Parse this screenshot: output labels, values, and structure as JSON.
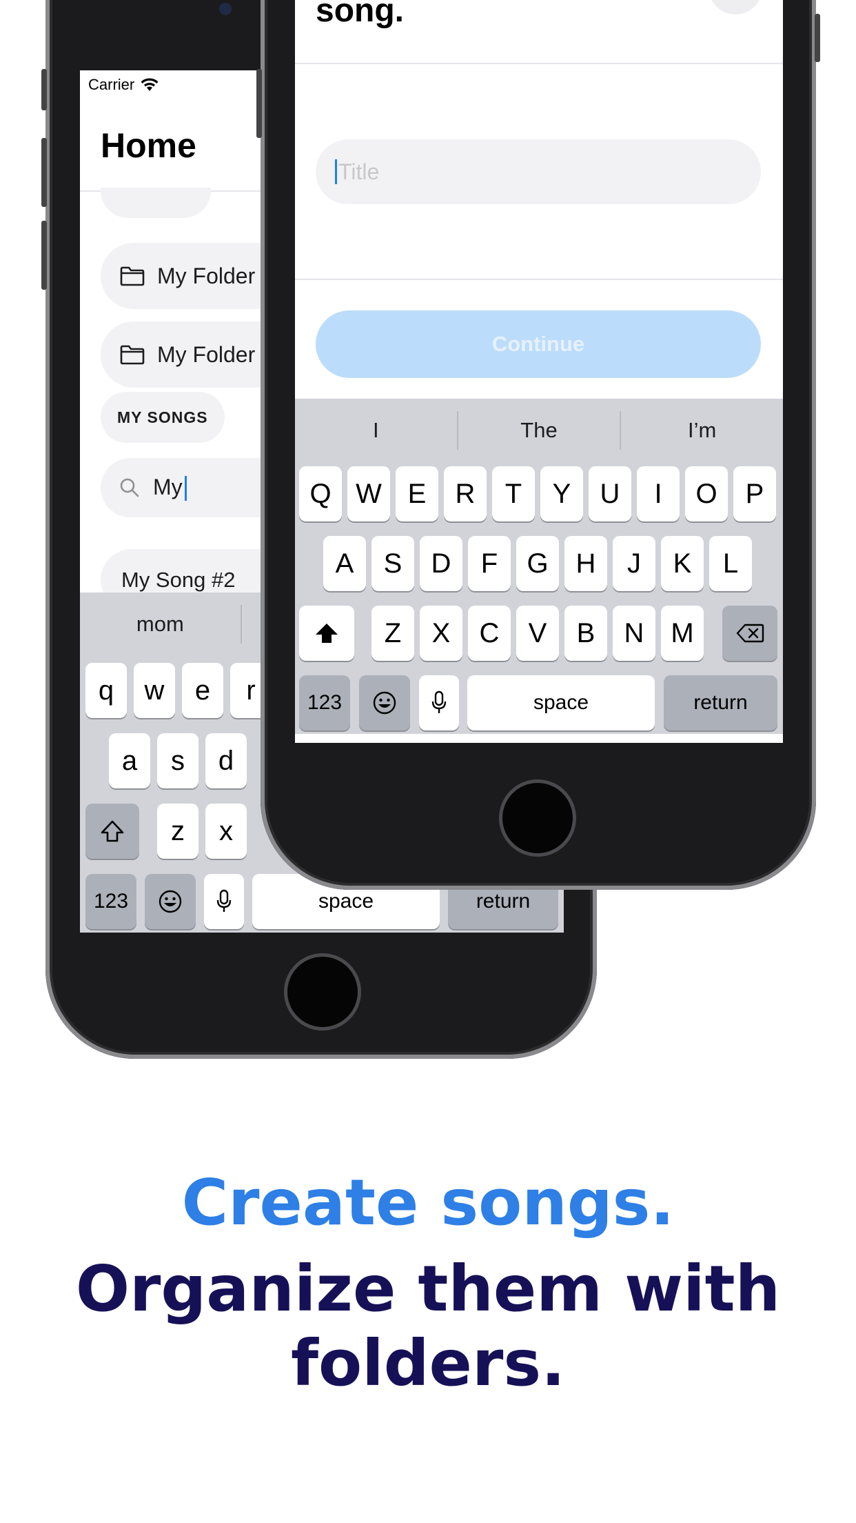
{
  "back_phone": {
    "status": {
      "carrier": "Carrier"
    },
    "header": {
      "title": "Home"
    },
    "folders": [
      {
        "label": "My Folder #"
      },
      {
        "label": "My Folder"
      }
    ],
    "section_label": "MY SONGS",
    "search": {
      "value": "My"
    },
    "songs": [
      {
        "title": "My Song #2"
      }
    ],
    "keyboard": {
      "suggestions": [
        "mom",
        ""
      ],
      "row1": [
        "q",
        "w",
        "e",
        "r"
      ],
      "row2": [
        "a",
        "s",
        "d"
      ],
      "row3": [
        "z",
        "x"
      ],
      "numbers_key": "123",
      "space_key": "space",
      "return_key": "return"
    }
  },
  "front_phone": {
    "dialog": {
      "title": "Enter a name for your song.",
      "input_placeholder": "Title",
      "continue_label": "Continue"
    },
    "keyboard": {
      "suggestions": [
        "I",
        "The",
        "I’m"
      ],
      "row1": [
        "Q",
        "W",
        "E",
        "R",
        "T",
        "Y",
        "U",
        "I",
        "O",
        "P"
      ],
      "row2": [
        "A",
        "S",
        "D",
        "F",
        "G",
        "H",
        "J",
        "K",
        "L"
      ],
      "row3": [
        "Z",
        "X",
        "C",
        "V",
        "B",
        "N",
        "M"
      ],
      "numbers_key": "123",
      "space_key": "space",
      "return_key": "return"
    }
  },
  "caption": {
    "line1": "Create songs.",
    "line2": "Organize them with folders."
  },
  "colors": {
    "accent_blue": "#2e7fe6",
    "navy": "#161157",
    "continue_disabled": "#bcdcfb",
    "caret": "#1e7ef2"
  }
}
